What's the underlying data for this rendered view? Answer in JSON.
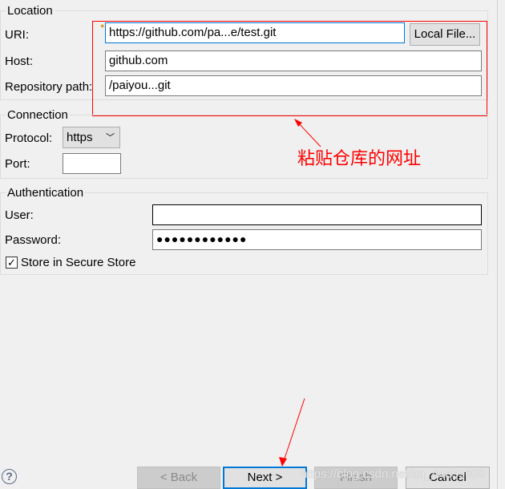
{
  "location": {
    "title": "Location",
    "uri_label": "URI:",
    "uri_value": "https://github.com/pa...e/test.git",
    "local_file": "Local File...",
    "host_label": "Host:",
    "host_value": "github.com",
    "repo_label": "Repository path:",
    "repo_value": "/paiyou...git"
  },
  "connection": {
    "title": "Connection",
    "protocol_label": "Protocol:",
    "protocol_value": "https",
    "port_label": "Port:",
    "port_value": ""
  },
  "auth": {
    "title": "Authentication",
    "user_label": "User:",
    "user_value": "",
    "password_label": "Password:",
    "password_value": "●●●●●●●●●●●●",
    "store_label": "Store in Secure Store",
    "store_checked": true
  },
  "annotation": {
    "text": "粘贴仓库的网址",
    "color": "#ff0000"
  },
  "buttons": {
    "back": "< Back",
    "next": "Next >",
    "finish": "Finish",
    "cancel": "Cancel"
  },
  "watermark": "https://blog.csdn.net/qq_44859600",
  "help": "?"
}
